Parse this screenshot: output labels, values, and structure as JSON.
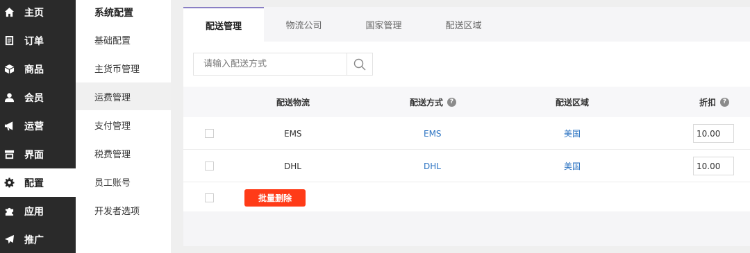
{
  "nav": {
    "items": [
      {
        "label": "主页",
        "icon": "home-icon"
      },
      {
        "label": "订单",
        "icon": "order-icon"
      },
      {
        "label": "商品",
        "icon": "box-icon"
      },
      {
        "label": "会员",
        "icon": "user-icon"
      },
      {
        "label": "运营",
        "icon": "megaphone-icon"
      },
      {
        "label": "界面",
        "icon": "layout-icon"
      },
      {
        "label": "配置",
        "icon": "gear-icon",
        "active": true
      },
      {
        "label": "应用",
        "icon": "puzzle-icon"
      },
      {
        "label": "推广",
        "icon": "paper-plane-icon"
      }
    ]
  },
  "subnav": {
    "title": "系统配置",
    "items": [
      {
        "label": "基础配置"
      },
      {
        "label": "主货币管理"
      },
      {
        "label": "运费管理",
        "active": true
      },
      {
        "label": "支付管理"
      },
      {
        "label": "税费管理"
      },
      {
        "label": "员工账号"
      },
      {
        "label": "开发者选项"
      }
    ]
  },
  "tabs": [
    {
      "label": "配送管理",
      "active": true
    },
    {
      "label": "物流公司"
    },
    {
      "label": "国家管理"
    },
    {
      "label": "配送区域"
    }
  ],
  "search": {
    "placeholder": "请输入配送方式"
  },
  "table": {
    "headers": {
      "logistics": "配送物流",
      "method": "配送方式",
      "region": "配送区域",
      "discount": "折扣"
    },
    "rows": [
      {
        "logistics": "EMS",
        "method": "EMS",
        "region": "美国",
        "discount": "10.00"
      },
      {
        "logistics": "DHL",
        "method": "DHL",
        "region": "美国",
        "discount": "10.00"
      }
    ]
  },
  "batch_delete_label": "批量删除",
  "colors": {
    "accent": "#8a7fc4",
    "danger": "#ff3b18",
    "link": "#2b73c2",
    "nav_bg": "#2a2a2a"
  }
}
